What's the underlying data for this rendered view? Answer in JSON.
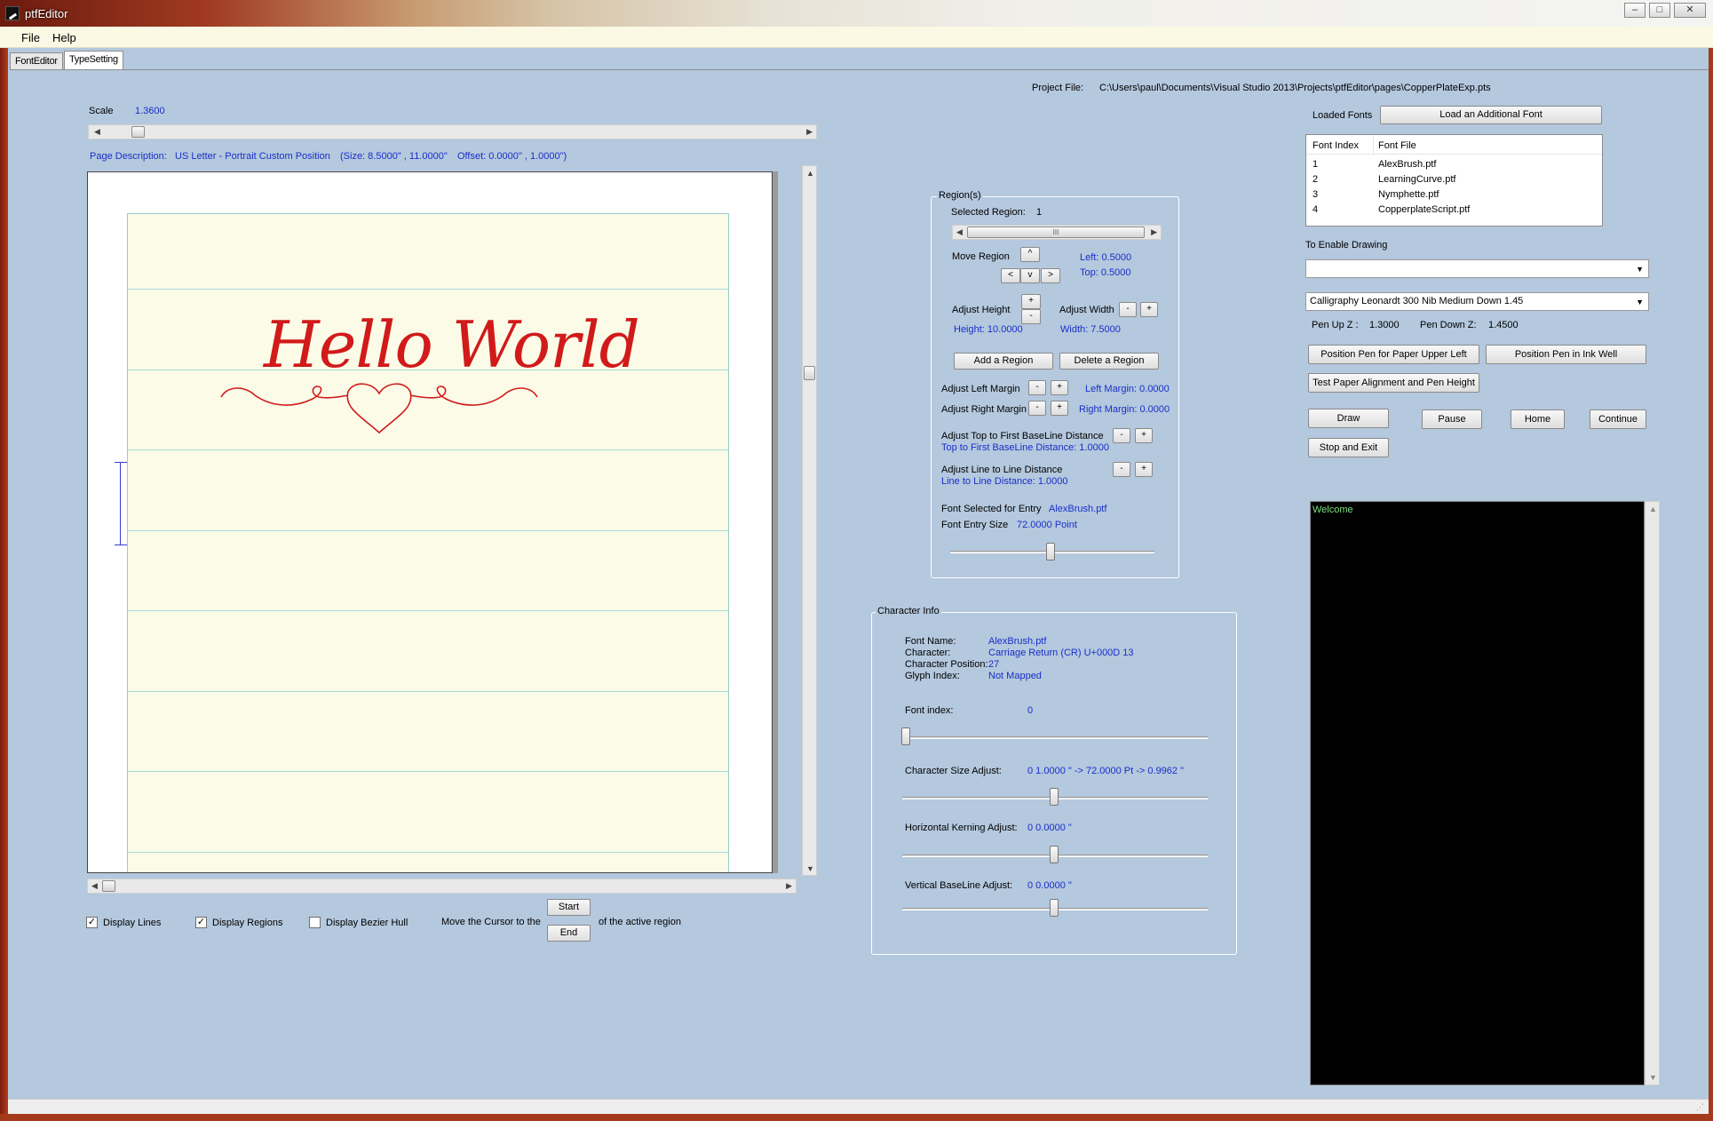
{
  "window": {
    "title": "ptfEditor",
    "min": "–",
    "max": "□",
    "close": "✕"
  },
  "menu": {
    "file": "File",
    "help": "Help"
  },
  "tabs": {
    "font_editor": "FontEditor",
    "type_setting": "TypeSetting"
  },
  "project": {
    "label": "Project File:",
    "path": "C:\\Users\\paul\\Documents\\Visual Studio 2013\\Projects\\ptfEditor\\pages\\CopperPlateExp.pts"
  },
  "scale": {
    "label": "Scale",
    "value": "1.3600"
  },
  "page_description": {
    "label": "Page Description:",
    "value": "US Letter - Portrait  Custom Position",
    "size": "(Size: 8.5000\" , 11.0000\"",
    "offset": "Offset: 0.0000\" , 1.0000\")"
  },
  "canvas": {
    "hello_world": "Hello World"
  },
  "display": {
    "lines_label": "Display Lines",
    "lines_checked": "✓",
    "regions_label": "Display Regions",
    "regions_checked": "✓",
    "bezier_label": "Display Bezier Hull",
    "bezier_checked": ""
  },
  "cursor": {
    "label": "Move the Cursor to the",
    "start": "Start",
    "end": "End",
    "suffix": "of the active region"
  },
  "regions": {
    "legend": "Region(s)",
    "selected_label": "Selected Region:",
    "selected_value": "1",
    "scroll_thumb": "III",
    "move_label": "Move Region",
    "up": "^",
    "left": "<",
    "down": "v",
    "right": ">",
    "left_value": "Left: 0.5000",
    "top_value": "Top: 0.5000",
    "adjust_height_label": "Adjust Height",
    "height_value": "Height: 10.0000",
    "adjust_width_label": "Adjust Width",
    "width_value": "Width: 7.5000",
    "plus": "+",
    "minus": "-",
    "add_region": "Add a Region",
    "delete_region": "Delete a Region",
    "adjust_left_margin": "Adjust Left Margin",
    "left_margin_value": "Left Margin: 0.0000",
    "adjust_right_margin": "Adjust Right Margin",
    "right_margin_value": "Right Margin: 0.0000",
    "adjust_top_baseline": "Adjust Top to First BaseLine Distance",
    "top_baseline_value": "Top to First BaseLine Distance: 1.0000",
    "adjust_line_distance": "Adjust  Line  to  Line  Distance",
    "line_distance_value": "Line to Line Distance: 1.0000",
    "font_selected_label": "Font Selected for Entry",
    "font_selected_value": "AlexBrush.ptf",
    "font_entry_size_label": "Font Entry Size",
    "font_entry_size_value": "72.0000  Point"
  },
  "character_info": {
    "legend": "Character Info",
    "font_name_label": "Font Name:",
    "font_name_value": "AlexBrush.ptf",
    "character_label": "Character:",
    "character_value": "Carriage Return (CR)  U+000D  13",
    "char_position_label": "Character Position:",
    "char_position_value": "27",
    "glyph_index_label": "Glyph Index:",
    "glyph_index_value": "Not Mapped",
    "font_index_label": "Font index:",
    "font_index_value": "0",
    "size_adjust_label": "Character Size Adjust:",
    "size_adjust_value": "0    1.0000  \"  -> 72.0000 Pt  -> 0.9962 \"",
    "kerning_label": "Horizontal Kerning Adjust:",
    "kerning_value": "0    0.0000  \"",
    "baseline_label": "Vertical BaseLine Adjust:",
    "baseline_value": "0    0.0000  \""
  },
  "fonts": {
    "loaded_label": "Loaded Fonts",
    "load_button": "Load an Additional Font",
    "col_index": "Font Index",
    "col_file": "Font File",
    "rows": [
      {
        "index": "1",
        "file": "AlexBrush.ptf"
      },
      {
        "index": "2",
        "file": "LearningCurve.ptf"
      },
      {
        "index": "3",
        "file": "Nymphette.ptf"
      },
      {
        "index": "4",
        "file": "CopperplateScript.ptf"
      }
    ]
  },
  "drawing": {
    "enable_label": "To Enable Drawing",
    "combo1_value": "",
    "combo2_value": "Calligraphy Leonardt 300 Nib Medium Down 1.45",
    "pen_up_label": "Pen Up Z :",
    "pen_up_value": "1.3000",
    "pen_down_label": "Pen Down Z:",
    "pen_down_value": "1.4500",
    "position_upper_left": "Position Pen for Paper Upper Left",
    "position_ink_well": "Position Pen in Ink Well",
    "test_alignment": "Test Paper Alignment and Pen Height",
    "draw": "Draw",
    "pause": "Pause",
    "home": "Home",
    "continue": "Continue",
    "stop_exit": "Stop and Exit"
  },
  "console": {
    "text": "Welcome"
  },
  "colors": {
    "accent_blue": "#1a2ec8",
    "ink_red": "#d11a1a",
    "panel_bg": "#b4c8de",
    "page_bg": "#fbfbe8",
    "console_bg": "#000000",
    "console_text": "#7ee07e"
  }
}
